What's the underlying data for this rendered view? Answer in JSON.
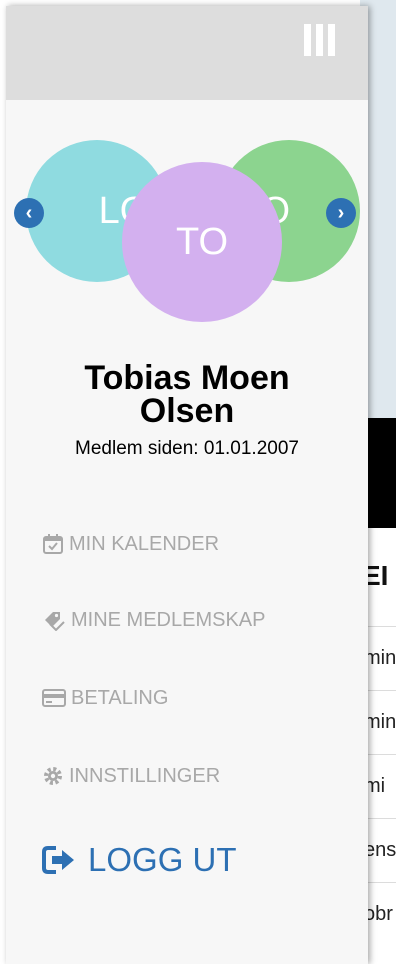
{
  "profile": {
    "name_line1": "Tobias Moen",
    "name_line2": "Olsen",
    "member_since_label": "Medlem siden:",
    "member_since_date": "01.01.2007"
  },
  "carousel": {
    "left_initials": "LO",
    "center_initials": "TO",
    "right_initials": "TO",
    "colors": {
      "left": "#8fdbe0",
      "center": "#d3b0ef",
      "right": "#8cd48f"
    }
  },
  "nav": {
    "items": [
      {
        "label": "MIN KALENDER",
        "icon": "calendar-check-icon"
      },
      {
        "label": "MINE MEDLEMSKAP",
        "icon": "tags-icon"
      },
      {
        "label": "BETALING",
        "icon": "credit-card-icon"
      },
      {
        "label": "INNSTILLINGER",
        "icon": "gear-icon"
      }
    ],
    "logout": {
      "label": "LOGG UT",
      "icon": "sign-out-icon"
    }
  },
  "background": {
    "heading_fragment": "EI",
    "rows": [
      "min",
      "min",
      "mi",
      "ens",
      "obr"
    ]
  },
  "colors": {
    "accent": "#2d70b3",
    "muted": "#a8a8a8"
  }
}
